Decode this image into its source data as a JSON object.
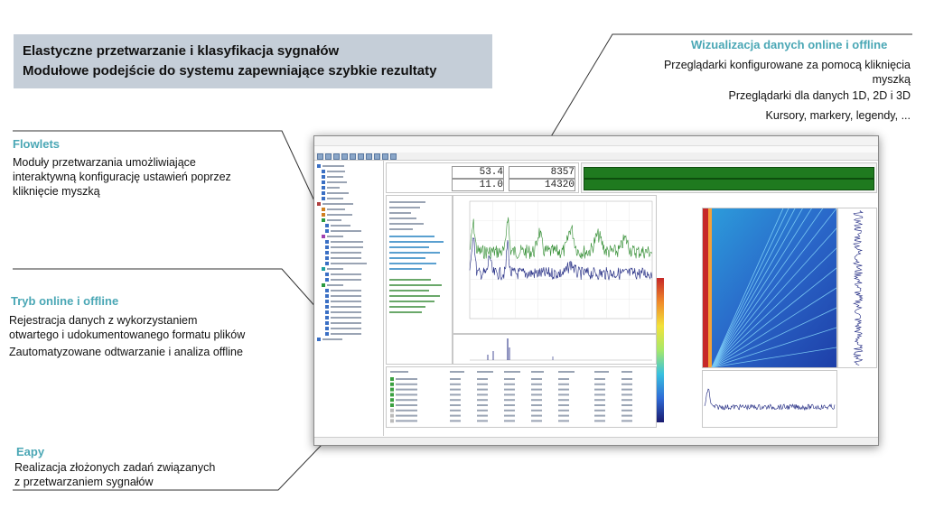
{
  "title": {
    "line1": "Elastyczne przetwarzanie i klasyfikacja sygnałów",
    "line2": "Modułowe podejście do systemu zapewniające szybkie rezultaty"
  },
  "visualization": {
    "heading": "Wizualizacja danych online i offline",
    "line1": "Przeglądarki konfigurowane za pomocą kliknięcia",
    "line2": "myszką",
    "line3": "Przeglądarki dla danych 1D, 2D i 3D",
    "line4": "Kursory, markery, legendy, ..."
  },
  "flowlets": {
    "heading": "Flowlets",
    "line1": "Moduły przetwarzania umożliwiające",
    "line2": "interaktywną konfigurację ustawień poprzez",
    "line3": "kliknięcie myszką"
  },
  "online_offline": {
    "heading": "Tryb online i offline",
    "line1": "Rejestracja danych z wykorzystaniem",
    "line2": "otwartego i udokumentowanego formatu plików",
    "line3": "Zautomatyzowane odtwarzanie i analiza offline"
  },
  "easy": {
    "heading": "Eapy",
    "line1": "Realizacja złożonych zadań związanych",
    "line2": "z przetwarzaniem sygnałów"
  },
  "app_window": {
    "meters": {
      "value1": "53.4",
      "value2": "11.0",
      "value3": "8357",
      "value4": "14320"
    }
  },
  "colors": {
    "accent": "#4aa7b5",
    "title_bg": "#c5ced8",
    "trace_green": "#2e8b2e",
    "trace_blue": "#1a237e",
    "meter_green": "#1f7a1f"
  }
}
